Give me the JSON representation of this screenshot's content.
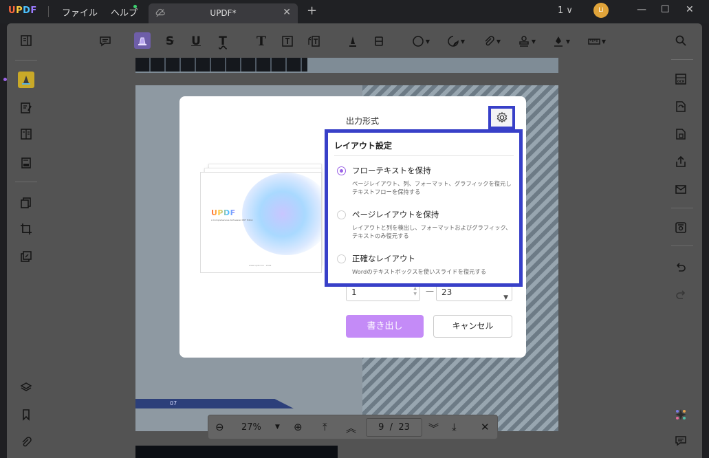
{
  "titlebar": {
    "logo": [
      "U",
      "P",
      "D",
      "F"
    ],
    "menu_file": "ファイル",
    "menu_help": "ヘルプ",
    "tab_title": "UPDF*",
    "tab_close": "✕",
    "new_tab": "+",
    "page_indicator": "1 ∨",
    "avatar_initials": "Li",
    "minimize": "—",
    "maximize": "☐",
    "close": "✕"
  },
  "toolbar": {
    "icons": [
      "comment-icon",
      "highlight-icon",
      "strikethrough-icon",
      "underline-icon",
      "squiggly-icon",
      "text-icon",
      "textbox-icon",
      "text-callout-icon",
      "pencil-icon",
      "eraser-icon",
      "shape-icon",
      "sticker-icon",
      "attachment-icon",
      "stamp-icon",
      "signature-icon",
      "measure-icon"
    ],
    "strike_glyph": "S",
    "underline_glyph": "U",
    "squiggly_glyph": "T",
    "text_glyph": "T"
  },
  "zoombar": {
    "zoom_out": "⊖",
    "zoom_value": "27%",
    "zoom_in": "⊕",
    "first_page": "⤒",
    "prev_page": "︽",
    "current_page": "9",
    "separator": "/",
    "total_pages": "23",
    "next_page": "︾",
    "last_page": "⤓",
    "close": "✕"
  },
  "document": {
    "page_label": "07"
  },
  "dialog": {
    "title": "出力形式",
    "thumbnail": {
      "logo": "UPDF",
      "subtitle": "A Comprehensive AI-Powered PDF Editor",
      "footer": "www.updf.com · 2024"
    },
    "range_from": "1",
    "range_dash": "—",
    "range_to": "23",
    "export_label": "書き出し",
    "cancel_label": "キャンセル"
  },
  "layout_settings": {
    "title": "レイアウト設定",
    "options": [
      {
        "label": "フローテキストを保持",
        "desc": "ページレイアウト、列、フォーマット、グラフィックを復元しテキストフローを保持する",
        "selected": true
      },
      {
        "label": "ページレイアウトを保持",
        "desc": "レイアウトと列を検出し、フォーマットおよびグラフィック、テキストのみ復元する",
        "selected": false
      },
      {
        "label": "正確なレイアウト",
        "desc": "Wordのテキストボックスを使いスライドを復元する",
        "selected": false
      }
    ]
  },
  "colors": {
    "accent": "#9b63e6",
    "highlight_frame": "#3840c8",
    "export_button": "#c48bf7"
  }
}
